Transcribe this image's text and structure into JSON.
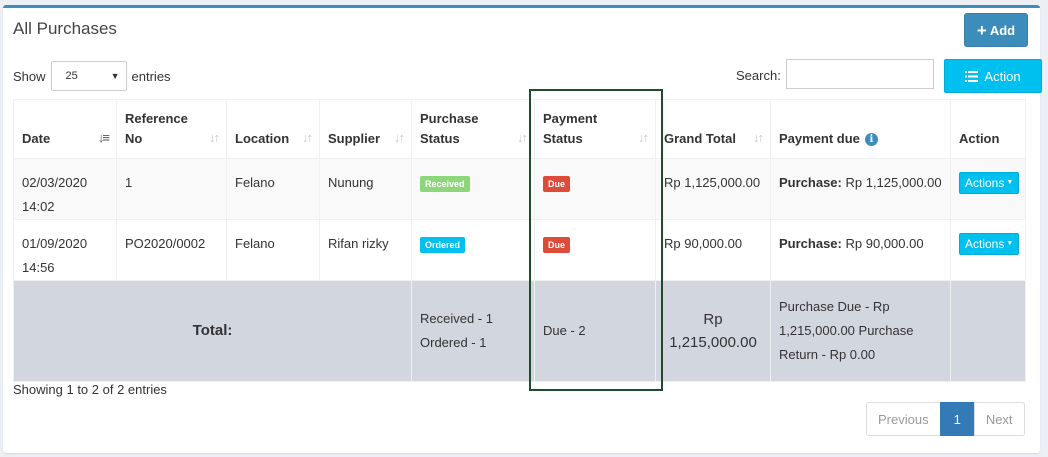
{
  "box": {
    "title": "All Purchases",
    "add_label": "Add"
  },
  "controls": {
    "show_label": "Show",
    "entries_value": "25",
    "entries_label": "entries",
    "search_label": "Search:",
    "search_value": "",
    "action_label": "Action"
  },
  "table": {
    "headers": {
      "date": "Date",
      "reference_1": "Reference",
      "reference_2": "No",
      "location": "Location",
      "supplier": "Supplier",
      "purchase_status_1": "Purchase",
      "purchase_status_2": "Status",
      "payment_status_1": "Payment",
      "payment_status_2": "Status",
      "grand_total": "Grand Total",
      "payment_due": "Payment due",
      "action": "Action"
    },
    "rows": [
      {
        "date": "02/03/2020",
        "time": "14:02",
        "reference": "1",
        "location": "Felano",
        "supplier": "Nunung",
        "purchase_status": "Received",
        "payment_status": "Due",
        "grand_total": "Rp 1,125,000.00",
        "payment_due_label": "Purchase:",
        "payment_due_value": " Rp 1,125,000.00",
        "action": "Actions"
      },
      {
        "date": "01/09/2020",
        "time": "14:56",
        "reference": "PO2020/0002",
        "location": "Felano",
        "supplier": "Rifan rizky",
        "purchase_status": "Ordered",
        "payment_status": "Due",
        "grand_total": "Rp 90,000.00",
        "payment_due_label": "Purchase:",
        "payment_due_value": " Rp 90,000.00",
        "action": "Actions"
      }
    ],
    "footer": {
      "total_label": "Total:",
      "received": "Received - 1",
      "ordered": "Ordered - 1",
      "due": "Due - 2",
      "grand_total_currency": "Rp",
      "grand_total_value": "1,215,000.00",
      "purchase_due_1": "Purchase Due - Rp",
      "purchase_due_2": "1,215,000.00",
      "purchase_return": "Purchase Return - Rp 0.00"
    }
  },
  "pagination": {
    "showing": "Showing 1 to 2 of 2 entries",
    "previous": "Previous",
    "current_page": "1",
    "next": "Next"
  },
  "colors": {
    "primary": "#3c8dbc",
    "info": "#00c0ef",
    "success_label": "#8ed67b",
    "danger_label": "#dd4b39",
    "highlight_border": "#1f4d2c"
  }
}
